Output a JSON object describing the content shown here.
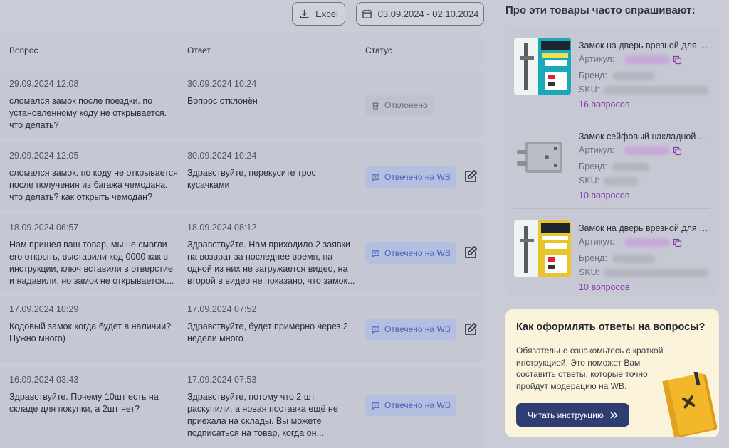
{
  "toolbar": {
    "excel_label": "Excel",
    "date_range": "03.09.2024 - 02.10.2024"
  },
  "table": {
    "headers": {
      "question": "Вопрос",
      "answer": "Ответ",
      "status": "Статус"
    },
    "rows": [
      {
        "q_date": "29.09.2024 12:08",
        "q_text": "сломался замок после поездки. по установленному коду не открывается. что делать?",
        "a_date": "30.09.2024 10:24",
        "a_text": "Вопрос отклонён",
        "status": "Отклонено"
      },
      {
        "q_date": "29.09.2024 12:05",
        "q_text": "сломался замок. по коду не открывается после получения из багажа чемодана. что делать? как открыть чемодан?",
        "a_date": "30.09.2024 10:24",
        "a_text": "Здравствуйте, перекусите трос кусачками",
        "status": "Отвечено на WB"
      },
      {
        "q_date": "18.09.2024 06:57",
        "q_text": "Нам пришел ваш товар, мы не смогли его открыть, выставили код 0000 как в инструкции, ключ вставили в отверстие и надавили, но замок не открывается....",
        "a_date": "18.09.2024 08:12",
        "a_text": "Здравствуйте. Нам приходило 2 заявки на возврат за последнее время, на одной из них не загружается видео, на второй в видео не показано, что замок...",
        "status": "Отвечено на WB"
      },
      {
        "q_date": "17.09.2024 10:29",
        "q_text": "Кодовый замок когда будет в наличии? Нужно много)",
        "a_date": "17.09.2024 07:52",
        "a_text": "Здравствуйте, будет примерно через 2 недели много",
        "status": "Отвечено на WB"
      },
      {
        "q_date": "16.09.2024 03:43",
        "q_text": "Здравствуйте. Почему 10шт есть на складе для покупки, а 2шт нет?",
        "a_date": "17.09.2024 07:53",
        "a_text": "Здравствуйте, потому что 2 шт раскупили, а новая поставка ещё не приехала на склады. Вы можете подписаться на товар, когда он...",
        "status": "Отвечено на WB"
      }
    ]
  },
  "sidebar": {
    "title": "Про эти товары часто спрашивают:",
    "labels": {
      "article": "Артикул:",
      "brand": "Бренд:",
      "sku": "SKU:"
    },
    "products": [
      {
        "title": "Замок на дверь врезной для к...",
        "count": "16 вопросов",
        "thumb": "teal"
      },
      {
        "title": "Замок сейфовый накладной З...",
        "count": "10 вопросов",
        "thumb": "steel"
      },
      {
        "title": "Замок на дверь врезной для к...",
        "count": "10 вопросов",
        "thumb": "yellow"
      }
    ]
  },
  "info": {
    "title": "Как оформлять ответы на вопросы?",
    "text": "Обязательно ознакомьтесь с краткой инструкцией. Это поможет Вам составить ответы, которые точно пройдут модерацию на WB.",
    "button": "Читать инструкцию"
  },
  "colors": {
    "background": "#c9ccd6",
    "answered_badge": "#b3bfe0",
    "answered_text": "#4a63b8",
    "count_purple": "#8a3ab0",
    "info_bg": "#fbf4da",
    "button_navy": "#2e3e72"
  }
}
